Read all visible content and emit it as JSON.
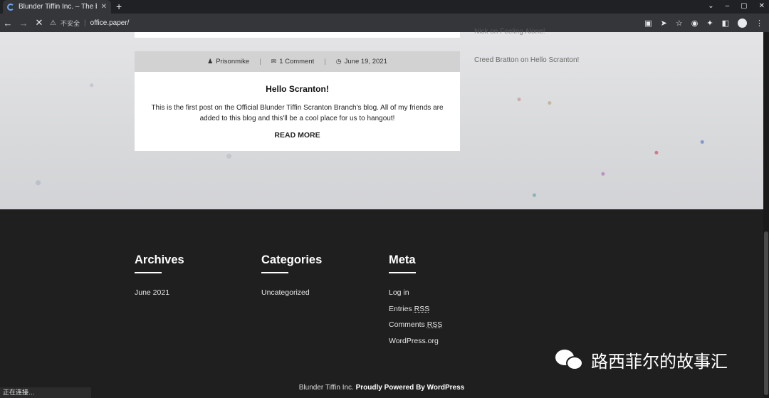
{
  "browser": {
    "tab_title": "Blunder Tiffin Inc. – The b",
    "tab_close": "✕",
    "new_tab": "+",
    "window_controls": [
      "⌄",
      "–",
      "▢",
      "✕"
    ],
    "security_label": "不安全",
    "url": "office.paper/",
    "status_text": "正在连接…"
  },
  "post_card": {
    "meta": {
      "author": "Prisonmike",
      "comments": "1 Comment",
      "date": "June 19, 2021"
    },
    "title": "Hello Scranton!",
    "excerpt": "This is the first post on the Official Blunder Tiffin Scranton Branch's blog. All of my friends are added to this blog and this'll be a cool place for us to hangout!",
    "read_more": "READ MORE"
  },
  "sidebar": {
    "recent_comments": [
      "Nick on Feeling Alone!",
      "Creed Bratton on Hello Scranton!"
    ]
  },
  "footer": {
    "archives": {
      "title": "Archives",
      "items": [
        "June 2021"
      ]
    },
    "categories": {
      "title": "Categories",
      "items": [
        "Uncategorized"
      ]
    },
    "meta": {
      "title": "Meta",
      "login": "Log in",
      "entries_prefix": "Entries ",
      "comments_prefix": "Comments ",
      "rss": "RSS",
      "wordpress": "WordPress.org"
    },
    "copyright_site": "Blunder Tiffin Inc.",
    "copyright_powered": "Proudly Powered By WordPress"
  },
  "watermark": {
    "text": "路西菲尔的故事汇"
  }
}
